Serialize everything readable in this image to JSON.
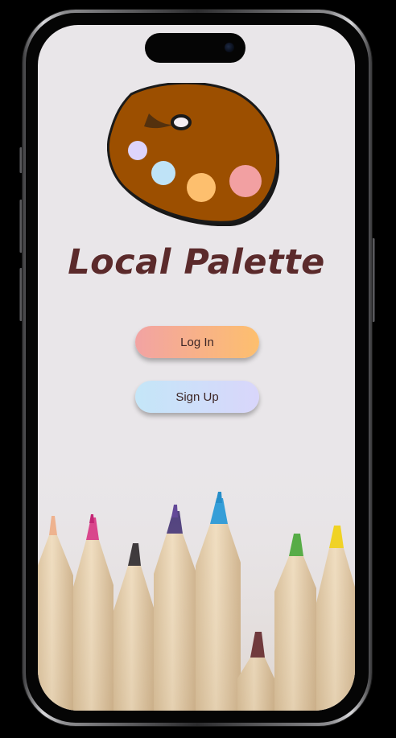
{
  "app": {
    "title": "Local Palette",
    "logo_icon": "paint-palette-icon"
  },
  "auth": {
    "login_label": "Log In",
    "signup_label": "Sign Up"
  },
  "colors": {
    "title": "#5b2a2b",
    "palette_body": "#9c4f00",
    "login_gradient": [
      "#f2a3a3",
      "#fdbf6e"
    ],
    "signup_gradient": [
      "#c4e6f8",
      "#d9d6fb"
    ],
    "screen_background": "#e9e6e9"
  },
  "decor": {
    "background_image": "colored-pencils-illustration",
    "pencil_tip_colors": [
      "#f0b08a",
      "#d93a86",
      "#2e2a2e",
      "#4a3a7a",
      "#2a9ad8",
      "#5c1e26",
      "#4aa93a",
      "#f2d316"
    ]
  }
}
